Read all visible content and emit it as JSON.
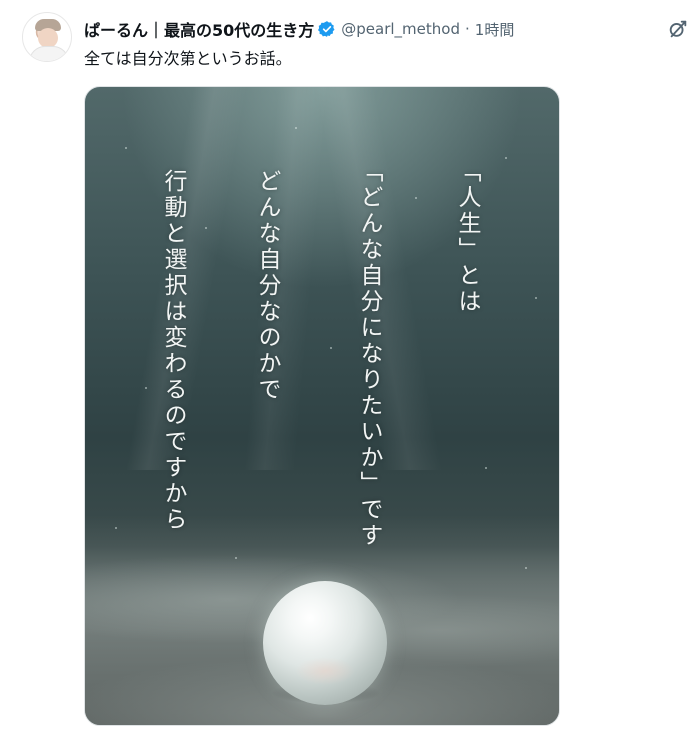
{
  "tweet": {
    "display_name": "ぱーるん｜最高の50代の生き方",
    "handle": "@pearl_method",
    "separator": "·",
    "time": "1時間",
    "text": "全ては自分次第というお話。"
  },
  "media": {
    "lines": [
      "「人生」とは",
      "「どんな自分になりたいか」です",
      "どんな自分なのかで",
      "行動と選択は変わるのですから"
    ]
  },
  "icons": {
    "verified": "verified-badge-icon",
    "grok": "grok-icon"
  },
  "colors": {
    "verified_blue": "#1d9bf0",
    "secondary_text": "#536471",
    "primary_text": "#0f1419"
  }
}
